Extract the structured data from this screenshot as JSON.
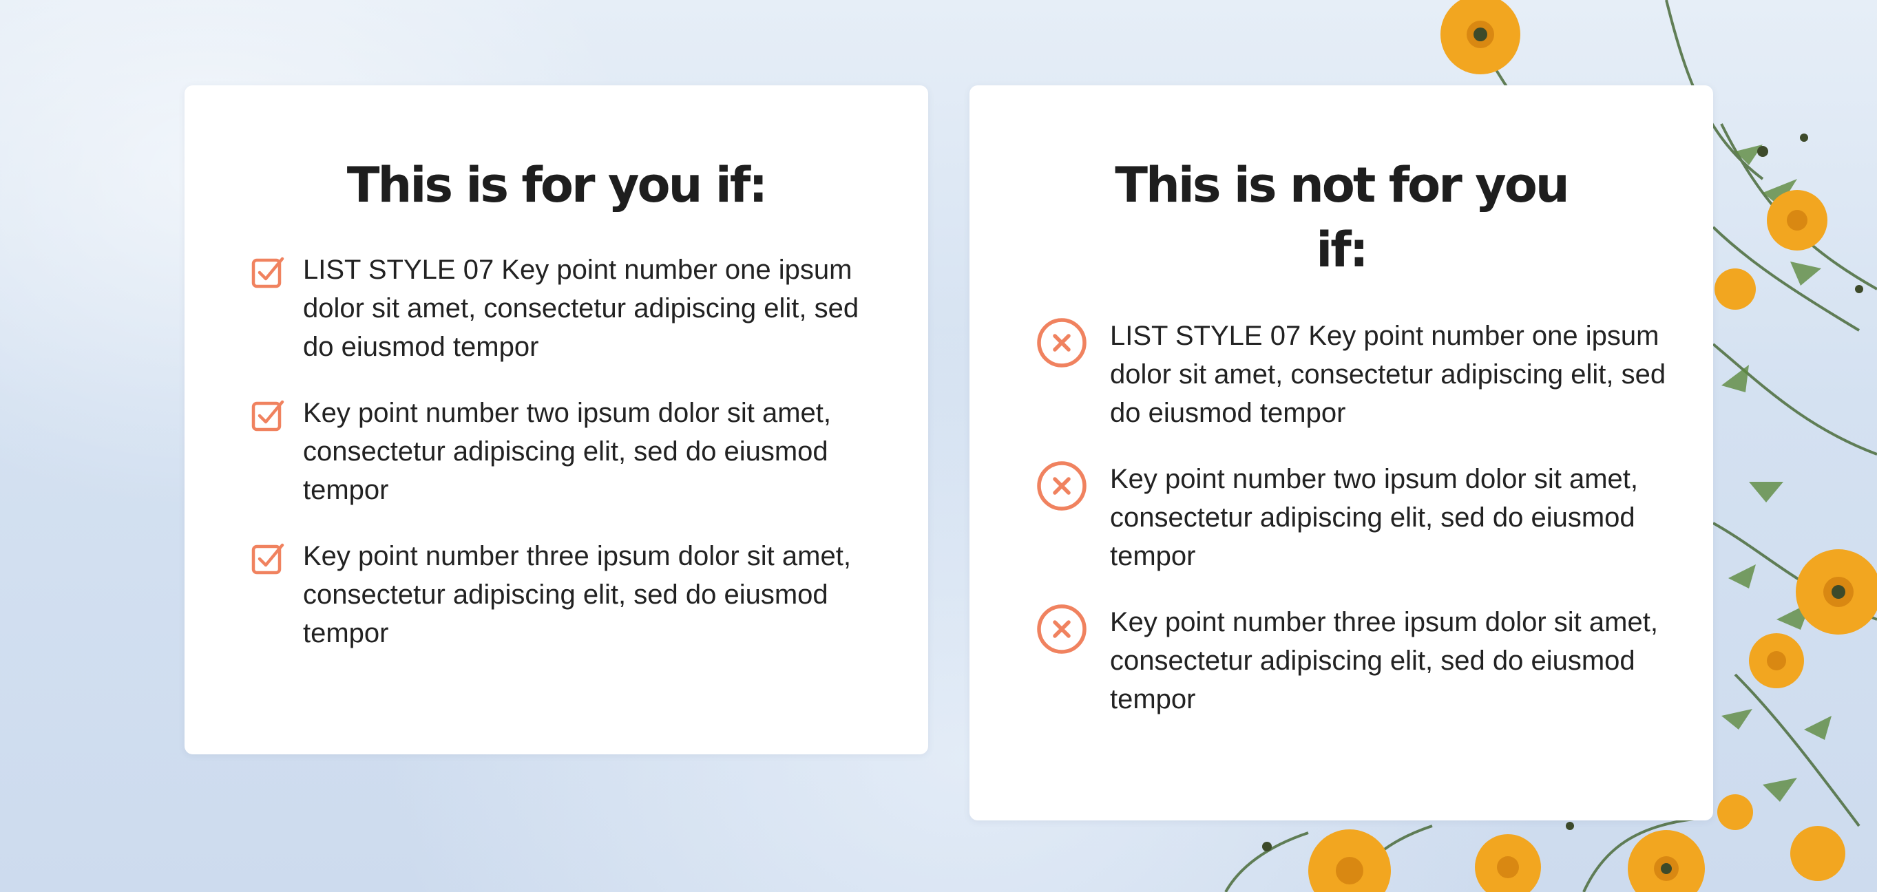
{
  "colors": {
    "accent": "#f0825f",
    "title": "#1e1e1e",
    "text": "#222222",
    "card_background": "#ffffff"
  },
  "left_card": {
    "title": "This is for you if:",
    "icon": "checked-box-icon",
    "items": [
      {
        "text": "LIST STYLE 07 Key point number one ipsum dolor sit amet, consectetur adipiscing elit, sed do eiusmod tempor"
      },
      {
        "text": "Key point number two ipsum dolor sit amet, consectetur adipiscing elit, sed do eiusmod tempor"
      },
      {
        "text": "Key point number three ipsum dolor sit amet, consectetur adipiscing elit, sed do eiusmod tempor"
      }
    ]
  },
  "right_card": {
    "title": "This is not for you if:",
    "icon": "circled-x-icon",
    "items": [
      {
        "text": "LIST STYLE 07 Key point number one ipsum dolor sit amet, consectetur adipiscing elit, sed do eiusmod tempor"
      },
      {
        "text": "Key point number two ipsum dolor sit amet, consectetur adipiscing elit, sed do eiusmod tempor"
      },
      {
        "text": "Key point number three ipsum dolor sit amet, consectetur adipiscing elit, sed do eiusmod tempor"
      }
    ]
  }
}
